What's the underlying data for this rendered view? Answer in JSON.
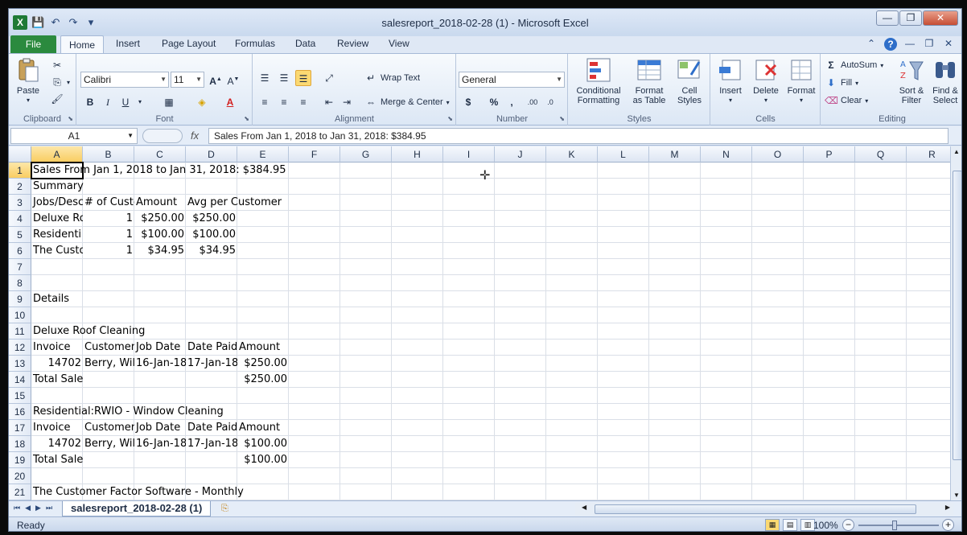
{
  "window": {
    "title": "salesreport_2018-02-28 (1)  -  Microsoft Excel",
    "app_icon": "X",
    "controls": {
      "minimize": "—",
      "restore": "❐",
      "close": "✕"
    }
  },
  "qat": {
    "save": "💾",
    "undo": "↶",
    "redo": "↷",
    "customize": "▾"
  },
  "tabs": {
    "file": "File",
    "items": [
      "Home",
      "Insert",
      "Page Layout",
      "Formulas",
      "Data",
      "Review",
      "View"
    ]
  },
  "ribbon": {
    "clipboard": {
      "paste": "Paste",
      "label": "Clipboard"
    },
    "font": {
      "name": "Calibri",
      "size": "11",
      "label": "Font",
      "bold": "B",
      "italic": "I",
      "underline": "U"
    },
    "alignment": {
      "wrap_text": "Wrap Text",
      "merge_center": "Merge & Center",
      "label": "Alignment"
    },
    "number": {
      "format": "General",
      "label": "Number",
      "currency": "$",
      "percent": "%",
      "comma": ","
    },
    "styles": {
      "conditional": [
        "Conditional",
        "Formatting"
      ],
      "format_table": [
        "Format",
        "as Table"
      ],
      "cell_styles": [
        "Cell",
        "Styles"
      ],
      "label": "Styles"
    },
    "cells": {
      "insert": "Insert",
      "delete": "Delete",
      "format": "Format",
      "label": "Cells"
    },
    "editing": {
      "autosum": "AutoSum",
      "fill": "Fill",
      "clear": "Clear",
      "sort": [
        "Sort &",
        "Filter"
      ],
      "find": [
        "Find &",
        "Select"
      ],
      "label": "Editing"
    }
  },
  "formula_bar": {
    "name_box": "A1",
    "fx": "fx",
    "content": "Sales From Jan 1, 2018 to Jan 31, 2018: $384.95"
  },
  "columns": [
    "A",
    "B",
    "C",
    "D",
    "E",
    "F",
    "G",
    "H",
    "I",
    "J",
    "K",
    "L",
    "M",
    "N",
    "O",
    "P",
    "Q",
    "R"
  ],
  "rows": [
    "1",
    "2",
    "3",
    "4",
    "5",
    "6",
    "7",
    "8",
    "9",
    "10",
    "11",
    "12",
    "13",
    "14",
    "15",
    "16",
    "17",
    "18",
    "19",
    "20",
    "21"
  ],
  "cells": {
    "r1": {
      "a": "Sales From Jan 1, 2018 to Jan 31, 2018: $384.95"
    },
    "r2": {
      "a": "Summary"
    },
    "r3": {
      "a": "Jobs/Desc",
      "b": "# of Custo",
      "c": "Amount",
      "d": "Avg per Customer"
    },
    "r4": {
      "a": "Deluxe Ro",
      "b": "1",
      "c": "$250.00",
      "d": "$250.00"
    },
    "r5": {
      "a": "Residenti",
      "b": "1",
      "c": "$100.00",
      "d": "$100.00"
    },
    "r6": {
      "a": "The Custo",
      "b": "1",
      "c": "$34.95",
      "d": "$34.95"
    },
    "r9": {
      "a": "Details"
    },
    "r11": {
      "a": "Deluxe Roof Cleaning"
    },
    "r12": {
      "a": "Invoice",
      "b": "Customer",
      "c": "Job Date",
      "d": "Date Paid",
      "e": "Amount"
    },
    "r13": {
      "a": "14702",
      "b": "Berry, Wil",
      "c": "16-Jan-18",
      "d": "17-Jan-18",
      "e": "$250.00"
    },
    "r14": {
      "a": "Total Sale",
      "e": "$250.00"
    },
    "r16": {
      "a": "Residential:RWIO - Window Cleaning"
    },
    "r17": {
      "a": "Invoice",
      "b": "Customer",
      "c": "Job Date",
      "d": "Date Paid",
      "e": "Amount"
    },
    "r18": {
      "a": "14702",
      "b": "Berry, Wil",
      "c": "16-Jan-18",
      "d": "17-Jan-18",
      "e": "$100.00"
    },
    "r19": {
      "a": "Total Sale",
      "e": "$100.00"
    },
    "r21": {
      "a": "The Customer Factor Software - Monthly"
    }
  },
  "sheet": {
    "tab": "salesreport_2018-02-28 (1)"
  },
  "status": {
    "text": "Ready",
    "zoom": "100%"
  }
}
